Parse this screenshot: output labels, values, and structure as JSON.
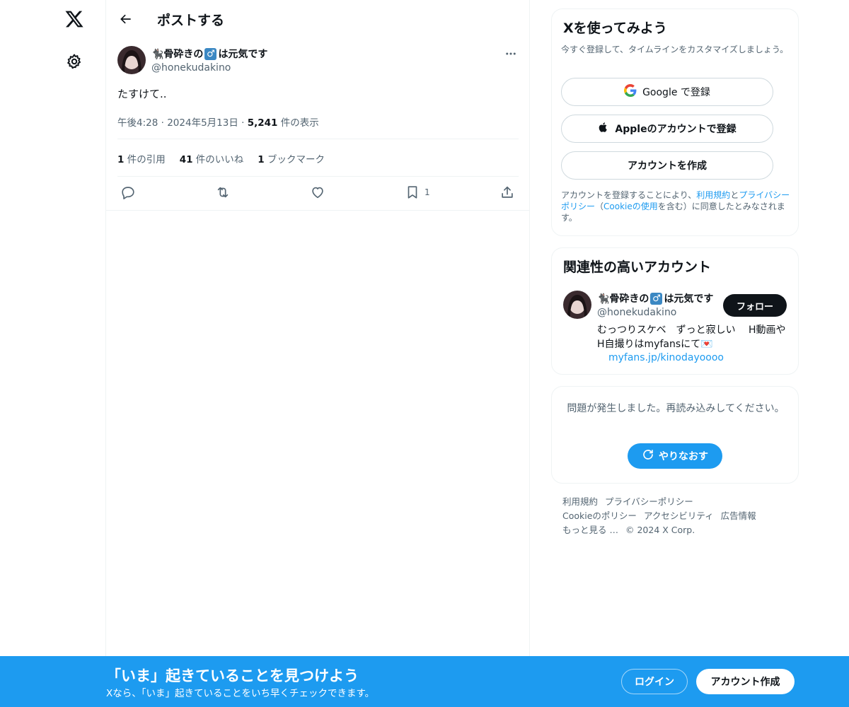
{
  "header": {
    "title": "ポストする"
  },
  "post": {
    "author_name_prefix": "🐈‍⬛骨砕きの",
    "author_name_symbol": "♂",
    "author_name_suffix": "は元気です",
    "author_handle": "@honekudakino",
    "text": "たすけて..",
    "time": "午後4:28",
    "date": "2024年5月13日",
    "views_count": "5,241",
    "views_label": "件の表示",
    "dot": "·",
    "stats": [
      {
        "count": "1",
        "label": "件の引用"
      },
      {
        "count": "41",
        "label": "件のいいね"
      },
      {
        "count": "1",
        "label": "ブックマーク"
      }
    ],
    "bookmark_count": "1"
  },
  "signup": {
    "title": "Xを使ってみよう",
    "subtitle": "今すぐ登録して、タイムラインをカスタマイズしましょう。",
    "google_label": "Google で登録",
    "apple_label": "Appleのアカウントで登録",
    "create_label": "アカウントを作成",
    "terms_1": "アカウントを登録することにより、",
    "terms_link_1": "利用規約",
    "terms_2": "と",
    "terms_link_2": "プライバシーポリシー",
    "terms_3": "（",
    "terms_link_3": "Cookieの使用",
    "terms_4": "を含む）に同意したとみなされます。"
  },
  "related": {
    "title": "関連性の高いアカウント",
    "name_prefix": "🐈‍⬛骨砕きの",
    "name_symbol": "♂",
    "name_suffix": "は元気です",
    "handle": "@honekudakino",
    "follow_label": "フォロー",
    "bio": "むっつりスケベ　ずっと寂しい　 H動画やH自撮りはmyfansにて💌",
    "link": "myfans.jp/kinodayoooo"
  },
  "error": {
    "text": "問題が発生しました。再読み込みしてください。",
    "retry_label": "やりなおす"
  },
  "footer": {
    "links": [
      "利用規約",
      "プライバシーポリシー",
      "Cookieのポリシー",
      "アクセシビリティ",
      "広告情報",
      "もっと見る …",
      "© 2024 X Corp."
    ]
  },
  "banner": {
    "title": "「いま」起きていることを見つけよう",
    "subtitle": "Xなら、「いま」起きていることをいち早くチェックできます。",
    "login_label": "ログイン",
    "create_label": "アカウント作成"
  },
  "colors": {
    "accent": "#1d9bf0",
    "text": "#0f1419",
    "muted": "#536471",
    "border": "#eff3f4"
  },
  "icons": [
    "x-logo-icon",
    "gear-icon",
    "back-arrow-icon",
    "more-icon",
    "reply-icon",
    "repost-icon",
    "like-icon",
    "bookmark-icon",
    "share-icon",
    "google-icon",
    "apple-icon",
    "refresh-icon"
  ]
}
